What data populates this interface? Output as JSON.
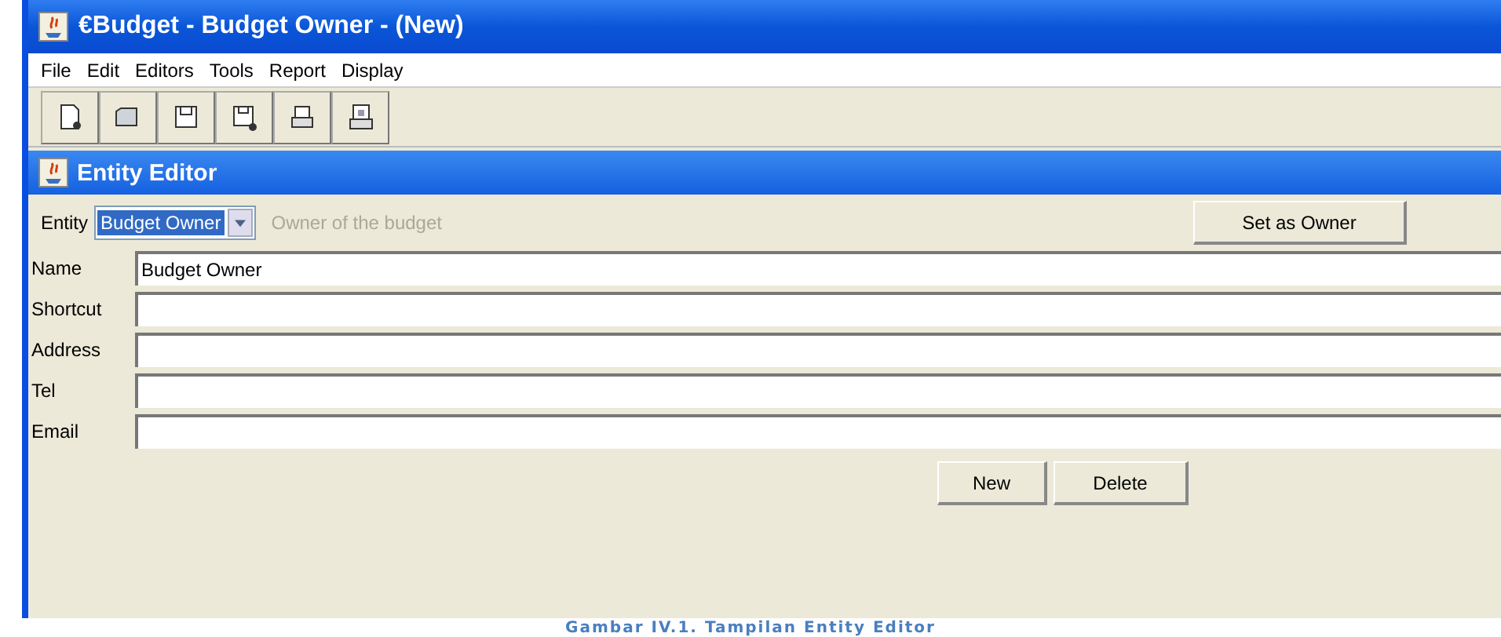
{
  "window": {
    "title": "€Budget - Budget Owner - (New)"
  },
  "menu": [
    "File",
    "Edit",
    "Editors",
    "Tools",
    "Report",
    "Display"
  ],
  "toolbar": [
    {
      "kind": "new"
    },
    {
      "kind": "open"
    },
    {
      "kind": "save"
    },
    {
      "kind": "saveas"
    },
    {
      "kind": "print"
    },
    {
      "kind": "preview"
    }
  ],
  "inner_frame": {
    "title": "Entity Editor"
  },
  "entity": {
    "label": "Entity",
    "value": "Budget Owner",
    "description": "Owner of the budget",
    "button": "Set as Owner"
  },
  "fields": [
    {
      "label": "Name",
      "value": "Budget Owner"
    },
    {
      "label": "Shortcut"
    },
    {
      "label": "Address"
    },
    {
      "label": "Tel"
    },
    {
      "label": "Email"
    }
  ],
  "buttons": [
    "New",
    "Delete"
  ],
  "caption": "Gambar IV.1. Tampilan Entity Editor"
}
